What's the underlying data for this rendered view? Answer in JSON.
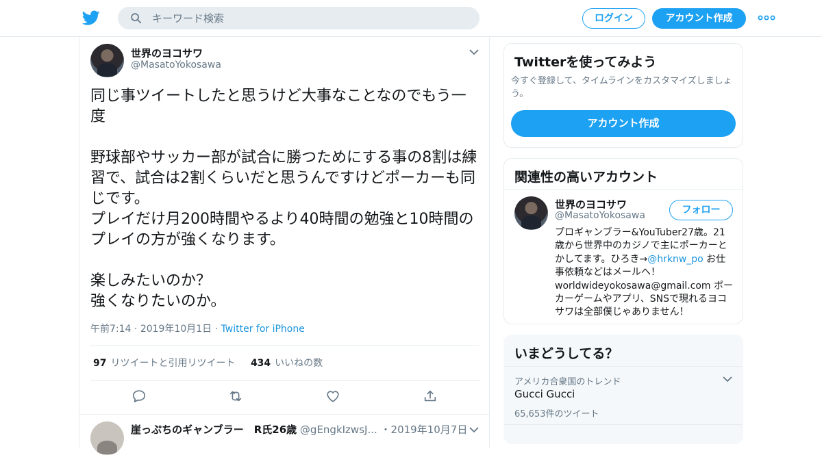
{
  "header": {
    "search_placeholder": "キーワード検索",
    "login_label": "ログイン",
    "signup_label": "アカウント作成"
  },
  "tweet": {
    "author_name": "世界のヨコサワ",
    "author_handle": "@MasatoYokosawa",
    "body": "同じ事ツイートしたと思うけど大事なことなのでもう一度\n\n野球部やサッカー部が試合に勝つためにする事の8割は練習で、試合は2割くらいだと思うんですけどポーカーも同じです。\nプレイだけ月200時間やるより40時間の勉強と10時間のプレイの方が強くなります。\n\n楽しみたいのか？\n強くなりたいのか。",
    "time": "午前7:14",
    "date": "2019年10月1日",
    "source": "Twitter for iPhone",
    "retweet_count": "97",
    "retweet_label": "リツイートと引用リツイート",
    "like_count": "434",
    "like_label": "いいねの数"
  },
  "reply": {
    "author_name": "崖っぷちのギャンブラー　R氏26歳",
    "author_handle": "@gEngkIzwsJ...",
    "date": "・2019年10月7日"
  },
  "signup_card": {
    "title": "Twitterを使ってみよう",
    "description": "今すぐ登録して、タイムラインをカスタマイズしましょう。",
    "button_label": "アカウント作成"
  },
  "related_card": {
    "title": "関連性の高いアカウント",
    "name": "世界のヨコサワ",
    "handle": "@MasatoYokosawa",
    "follow_label": "フォロー",
    "bio_before": "プロギャンブラー&YouTuber27歳。21歳から世界中のカジノで主にポーカーとかしてます。ひろき→",
    "bio_link": "@hrknw_po",
    "bio_after": " お仕事依頼などはメールへ！ worldwideyokosawa@gmail.com ポーカーゲームやアプリ、SNSで現れるヨコサワは全部僕じゃありません！"
  },
  "trends_card": {
    "title": "いまどうしてる？",
    "context": "アメリカ合衆国のトレンド",
    "name": "Gucci Gucci",
    "count": "65,653件のツイート"
  },
  "colors": {
    "accent": "#1da1f2",
    "link": "#1b95e0",
    "secondary_text": "#657786"
  }
}
